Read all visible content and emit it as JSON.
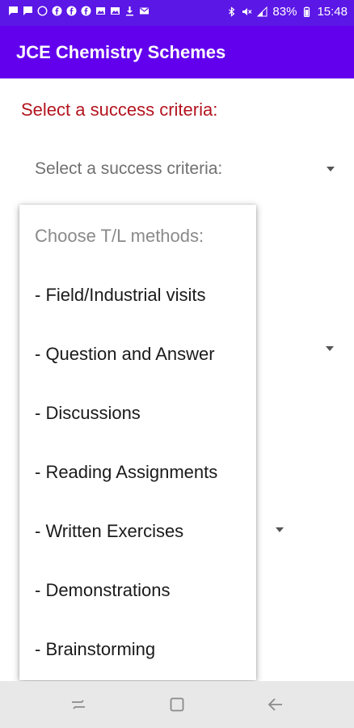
{
  "status_bar": {
    "notification_icons": [
      "chat-icon",
      "chat-icon",
      "whatsapp-icon",
      "facebook-icon",
      "facebook-icon",
      "facebook-icon",
      "photo-icon",
      "photo-icon",
      "download-icon",
      "gmail-icon"
    ],
    "battery": "83%",
    "time": "15:48"
  },
  "app_bar": {
    "title": "JCE Chemistry Schemes"
  },
  "colors": {
    "app_bar": "#6200ee",
    "status_bar": "#5b17e6",
    "label_red": "#b3141f"
  },
  "main": {
    "criteria_label": "Select a success criteria:",
    "criteria_spinner": {
      "selected": "Select a success criteria:"
    }
  },
  "methods_popup": {
    "items": [
      "Choose T/L methods:",
      "- Field/Industrial visits",
      "- Question and Answer",
      "- Discussions",
      "- Reading Assignments",
      "- Written Exercises",
      "- Demonstrations",
      "- Brainstorming"
    ]
  },
  "nav_bar": {
    "buttons": [
      "recents-icon",
      "home-icon",
      "back-icon"
    ]
  }
}
